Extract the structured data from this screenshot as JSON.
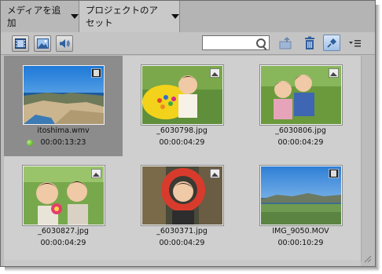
{
  "tabs": [
    {
      "label": "メディアを追加"
    },
    {
      "label": "プロジェクトのアセット"
    }
  ],
  "toolbar": {
    "search_value": "",
    "icons": [
      "video-filter-icon",
      "image-filter-icon",
      "audio-filter-icon",
      "new-folder-icon",
      "trash-icon",
      "pin-icon",
      "panel-menu-icon"
    ]
  },
  "assets": [
    {
      "name": "itoshima.wmv",
      "duration": "00:00:13:23",
      "type": "video",
      "selected": true,
      "in_use": true
    },
    {
      "name": "_6030798.jpg",
      "duration": "00:00:04:29",
      "type": "image",
      "selected": false,
      "in_use": false
    },
    {
      "name": "_6030806.jpg",
      "duration": "00:00:04:29",
      "type": "image",
      "selected": false,
      "in_use": false
    },
    {
      "name": "_6030827.jpg",
      "duration": "00:00:04:29",
      "type": "image",
      "selected": false,
      "in_use": false
    },
    {
      "name": "_6030371.jpg",
      "duration": "00:00:04:29",
      "type": "image",
      "selected": false,
      "in_use": false
    },
    {
      "name": "IMG_9050.MOV",
      "duration": "00:00:10:29",
      "type": "video",
      "selected": false,
      "in_use": false
    }
  ],
  "colors": {
    "panel": "#bdbdbd",
    "selection": "#8c8c8c",
    "in_use_dot": "#3f9b12"
  }
}
